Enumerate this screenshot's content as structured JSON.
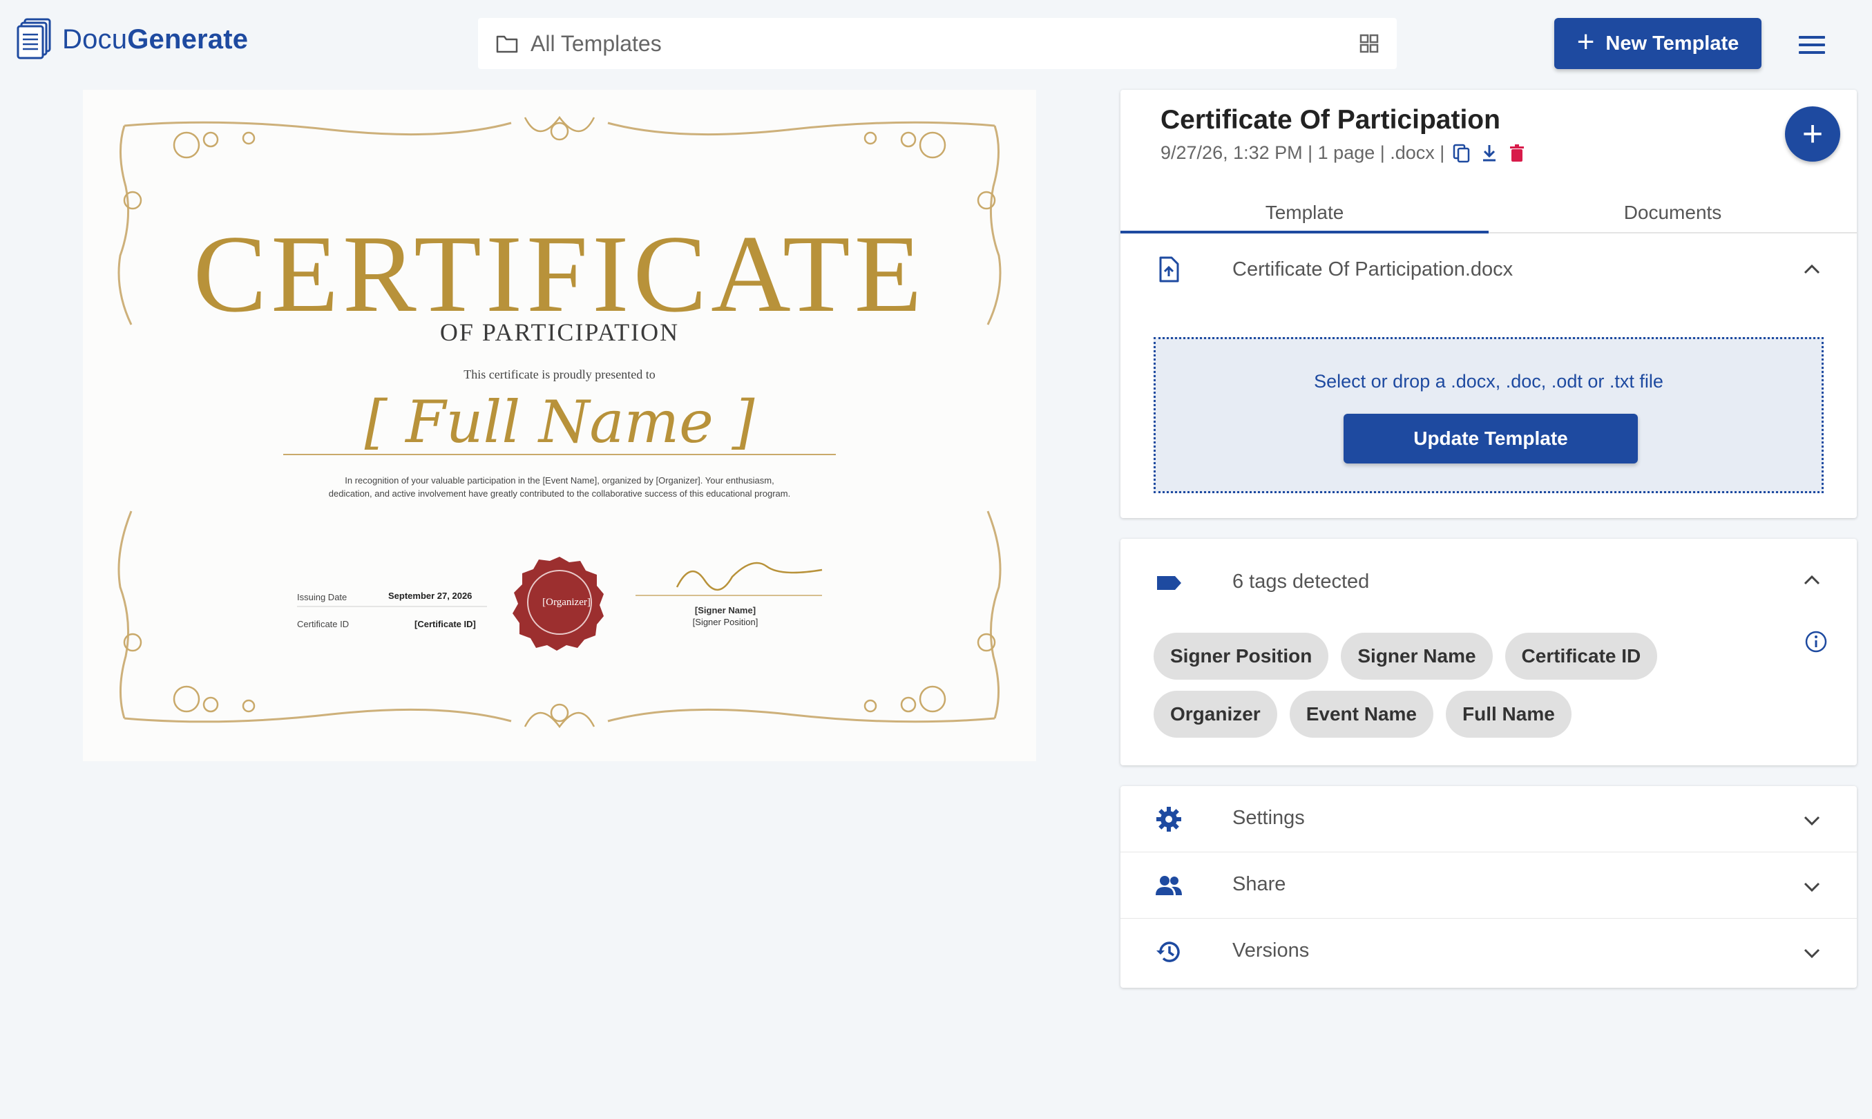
{
  "brand": {
    "prefix": "Docu",
    "suffix": "Generate",
    "color": "#1e4aa0"
  },
  "search": {
    "placeholder": "All Templates",
    "icon": "folder-icon",
    "view_icon": "grid-view-icon"
  },
  "toolbar": {
    "new_template_label": "New Template",
    "menu_icon": "hamburger-menu-icon"
  },
  "certificate": {
    "title": "CERTIFICATE",
    "subtitle": "OF PARTICIPATION",
    "presented": "This certificate is proudly presented to",
    "name": "[ Full Name ]",
    "body_line1": "In recognition of your valuable participation in the [Event Name], organized by [Organizer]. Your enthusiasm,",
    "body_line2": "dedication, and active involvement have greatly contributed to the collaborative success of this educational program.",
    "issuing_label": "Issuing Date",
    "issuing_value": "September 27, 2026",
    "cert_id_label": "Certificate ID",
    "cert_id_value": "[Certificate ID]",
    "seal_text": "[Organizer]",
    "signer_name": "[Signer Name]",
    "signer_position": "[Signer Position]",
    "gold": "#b8923a",
    "seal_red": "#9c2f2f"
  },
  "template": {
    "title": "Certificate Of Participation",
    "meta": "9/27/26, 1:32 PM | 1 page | .docx |",
    "meta_icons": [
      "copy-icon",
      "download-icon",
      "delete-icon"
    ],
    "add_icon": "plus-icon"
  },
  "tabs": [
    {
      "label": "Template",
      "active": true
    },
    {
      "label": "Documents",
      "active": false
    }
  ],
  "file_section": {
    "filename": "Certificate Of Participation.docx",
    "icon": "file-upload-icon",
    "dropzone_text": "Select or drop a .docx, .doc, .odt or .txt file",
    "update_label": "Update Template"
  },
  "tags_section": {
    "label": "6 tags detected",
    "icon": "tag-icon",
    "tags": [
      "Signer Position",
      "Signer Name",
      "Certificate ID",
      "Organizer",
      "Event Name",
      "Full Name"
    ]
  },
  "accordion": [
    {
      "label": "Settings",
      "icon": "gear-icon"
    },
    {
      "label": "Share",
      "icon": "people-icon"
    },
    {
      "label": "Versions",
      "icon": "history-icon"
    }
  ],
  "colors": {
    "accent": "#1e4aa0",
    "danger": "#d81b4a",
    "background": "#f3f6f9"
  }
}
